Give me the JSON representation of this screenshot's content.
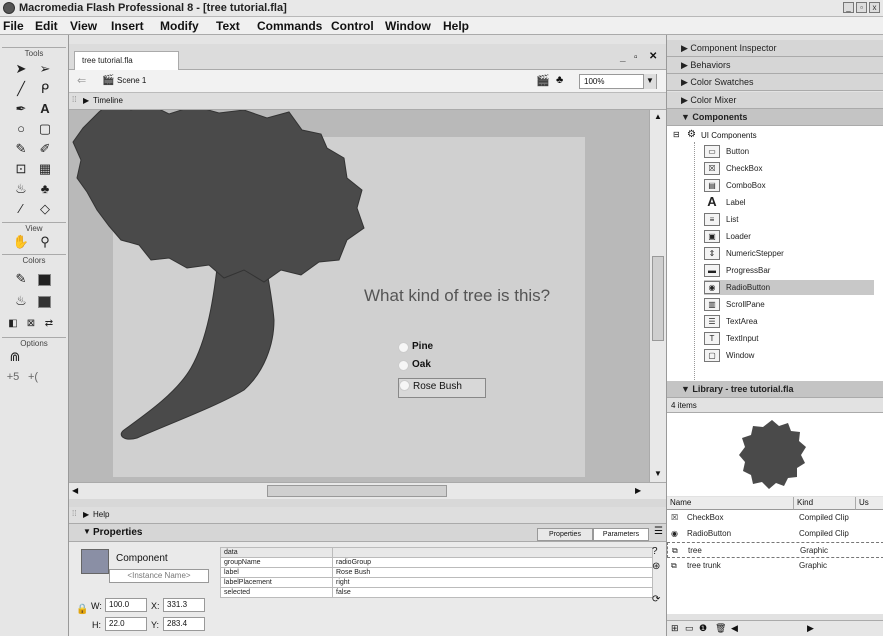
{
  "window": {
    "title": "Macromedia Flash Professional 8 - [tree tutorial.fla]"
  },
  "menu": [
    "File",
    "Edit",
    "View",
    "Insert",
    "Modify",
    "Text",
    "Commands",
    "Control",
    "Window",
    "Help"
  ],
  "tools": {
    "tools_label": "Tools",
    "view_label": "View",
    "colors_label": "Colors",
    "options_label": "Options"
  },
  "document": {
    "tab": "tree tutorial.fla",
    "scene": "Scene 1",
    "zoom": "100%",
    "timeline_label": "Timeline"
  },
  "stage": {
    "question": "What kind of tree is this?",
    "options": [
      "Pine",
      "Oak",
      "Rose Bush"
    ]
  },
  "help_label": "Help",
  "properties": {
    "title": "Properties",
    "tab_properties": "Properties",
    "tab_parameters": "Parameters",
    "component_label": "Component",
    "instance_placeholder": "<Instance Name>",
    "w_label": "W:",
    "w": "100.0",
    "h_label": "H:",
    "h": "22.0",
    "x_label": "X:",
    "x": "331.3",
    "y_label": "Y:",
    "y": "283.4",
    "params": [
      {
        "name": "data",
        "value": ""
      },
      {
        "name": "groupName",
        "value": "radioGroup"
      },
      {
        "name": "label",
        "value": "Rose Bush"
      },
      {
        "name": "labelPlacement",
        "value": "right"
      },
      {
        "name": "selected",
        "value": "false"
      }
    ]
  },
  "panels": {
    "component_inspector": "Component Inspector",
    "behaviors": "Behaviors",
    "color_swatches": "Color Swatches",
    "color_mixer": "Color Mixer",
    "components": "Components",
    "ui_components": "UI Components",
    "items": [
      "Button",
      "CheckBox",
      "ComboBox",
      "Label",
      "List",
      "Loader",
      "NumericStepper",
      "ProgressBar",
      "RadioButton",
      "ScrollPane",
      "TextArea",
      "TextInput",
      "Window"
    ],
    "library_title": "Library - tree tutorial.fla",
    "library_count": "4 items",
    "lib_col_name": "Name",
    "lib_col_kind": "Kind",
    "lib_col_use": "Us",
    "library_items": [
      {
        "name": "CheckBox",
        "kind": "Compiled Clip"
      },
      {
        "name": "RadioButton",
        "kind": "Compiled Clip"
      },
      {
        "name": "tree",
        "kind": "Graphic"
      },
      {
        "name": "tree trunk",
        "kind": "Graphic"
      }
    ]
  },
  "colors": {
    "tree": "#4a4a4a",
    "stage": "#d0d0d0",
    "work": "#b9b9b9"
  }
}
